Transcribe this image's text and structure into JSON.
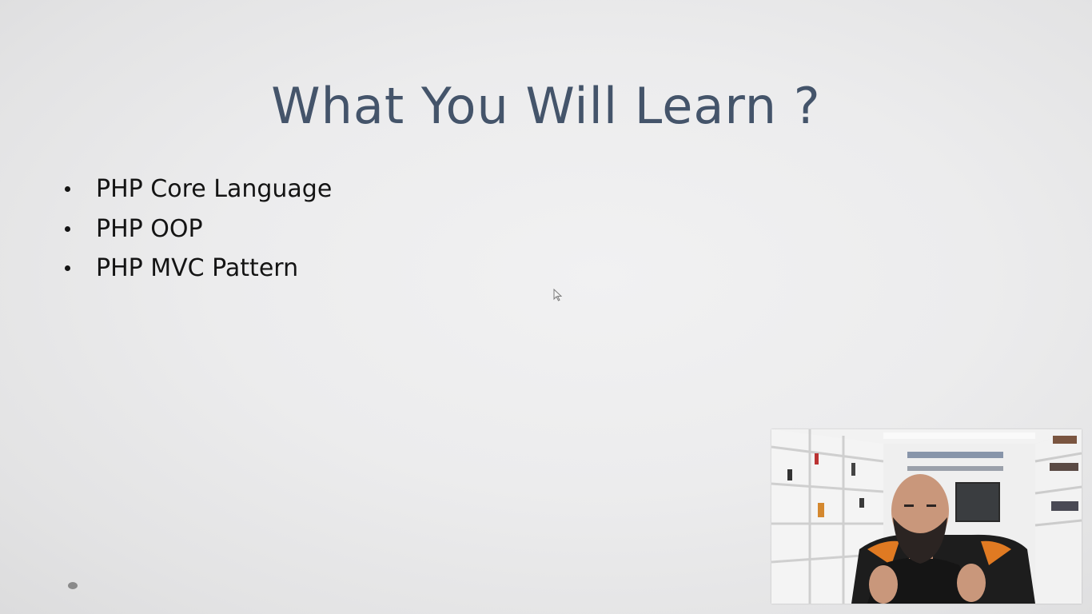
{
  "slide": {
    "title": "What You Will Learn ?",
    "bullets": [
      "PHP Core Language",
      "PHP OOP",
      "PHP MVC Pattern"
    ]
  },
  "colors": {
    "title": "#44546a",
    "bullet_text": "#141414",
    "background": "#ececed"
  },
  "icons": {
    "cursor": "mouse-pointer-icon",
    "slide_indicator": "slide-indicator-dot-icon"
  }
}
